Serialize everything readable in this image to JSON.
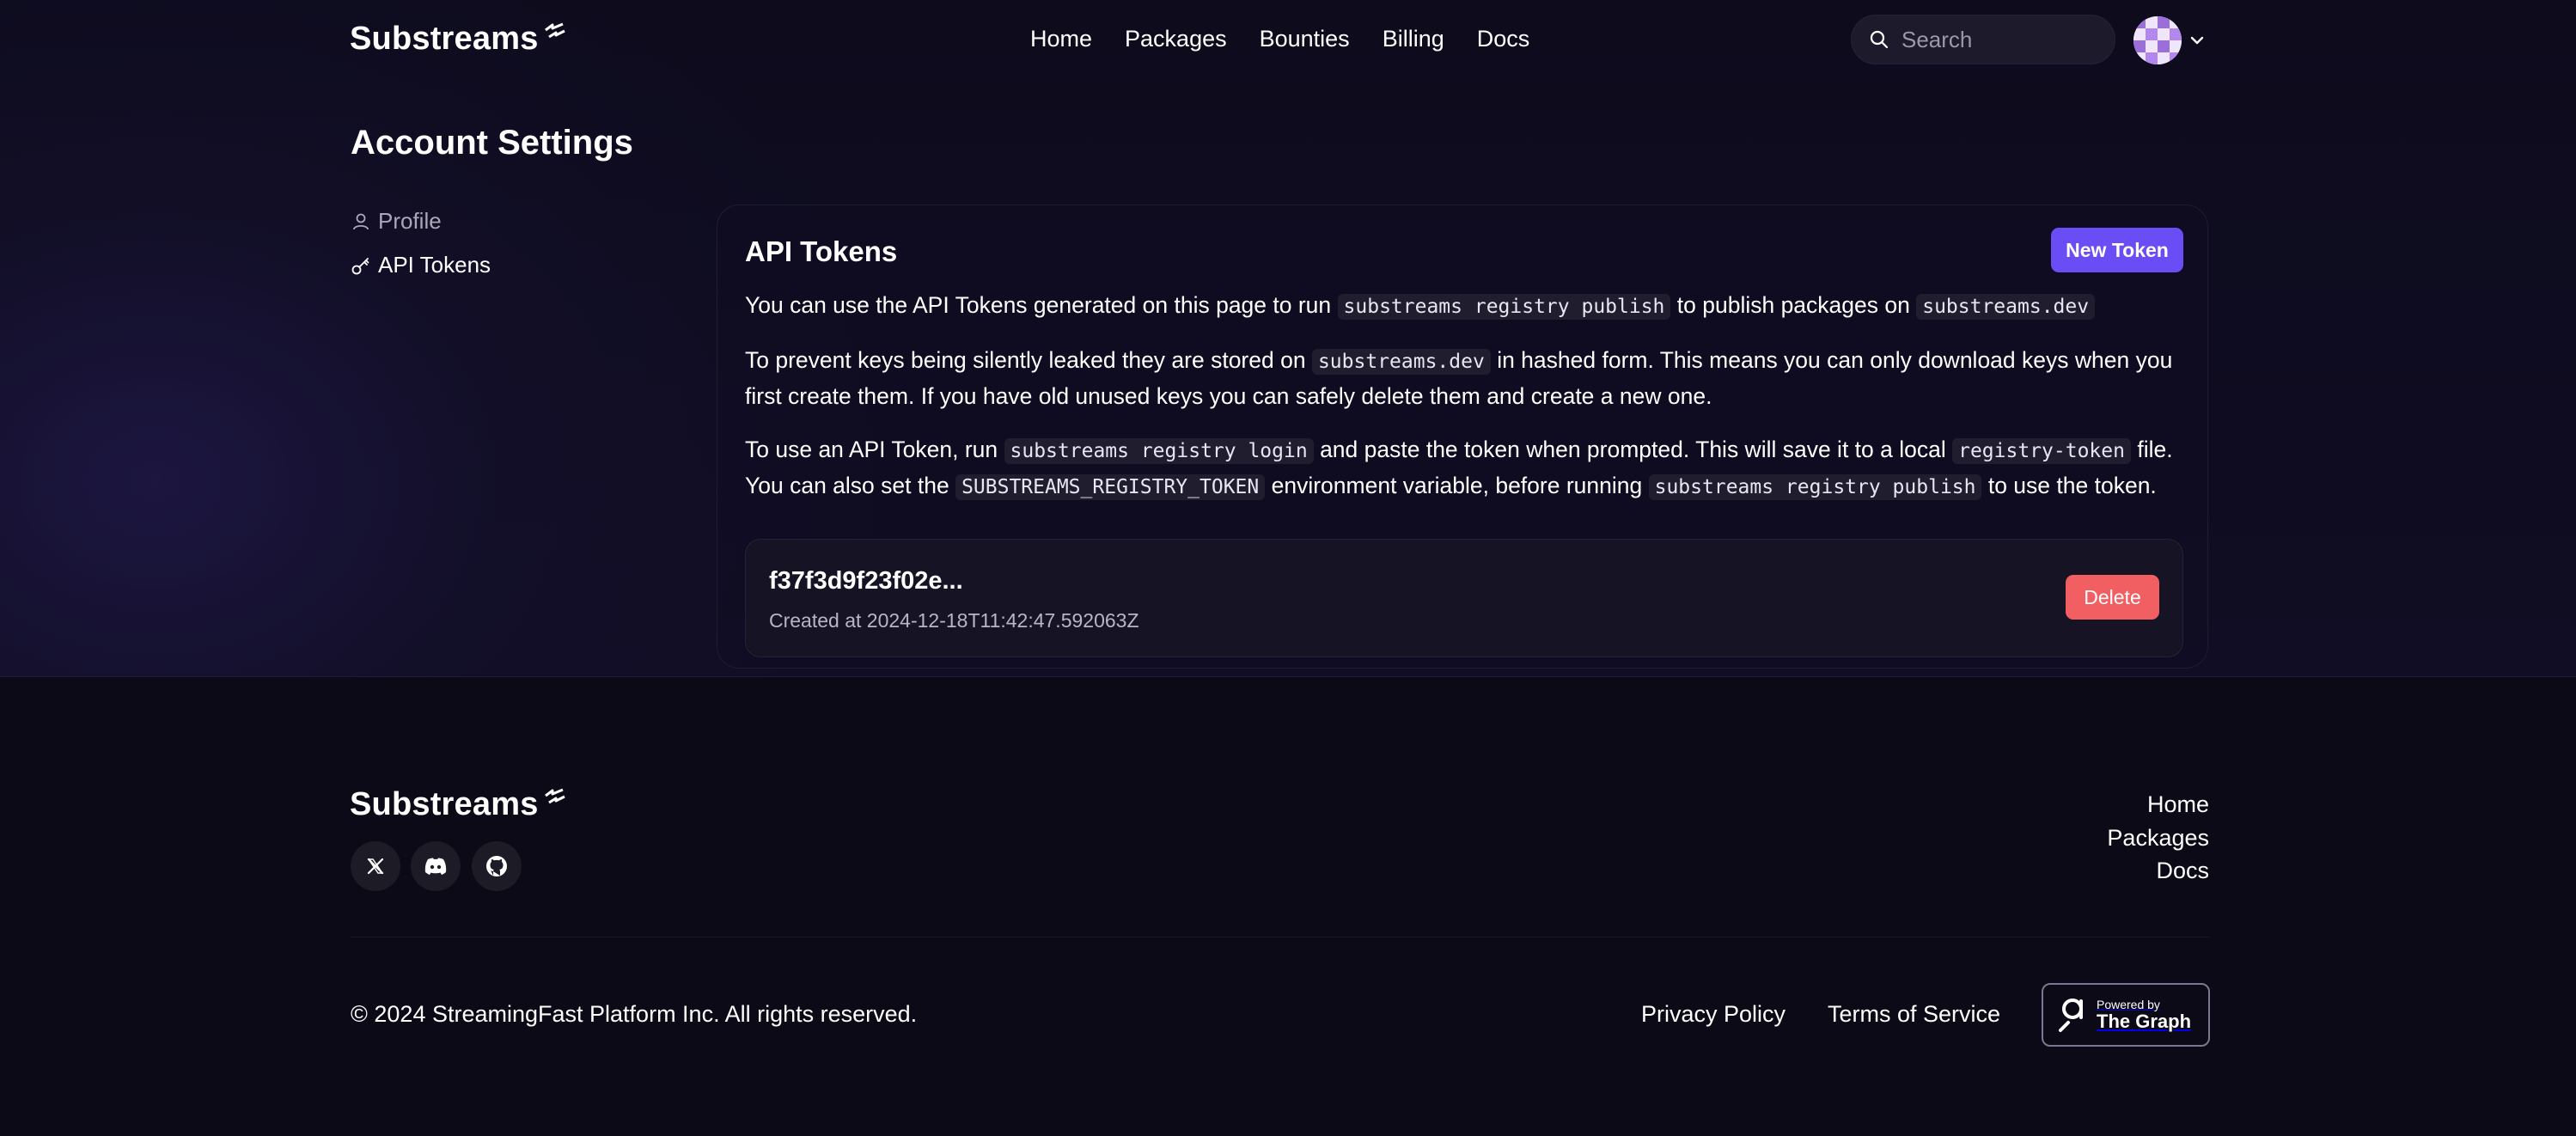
{
  "header": {
    "logo": "Substreams",
    "nav": [
      {
        "label": "Home"
      },
      {
        "label": "Packages"
      },
      {
        "label": "Bounties"
      },
      {
        "label": "Billing"
      },
      {
        "label": "Docs"
      }
    ],
    "search_placeholder": "Search"
  },
  "page": {
    "title": "Account Settings"
  },
  "sidebar": {
    "items": [
      {
        "label": "Profile",
        "icon": "user-icon"
      },
      {
        "label": "API Tokens",
        "icon": "key-icon"
      }
    ]
  },
  "tokens_card": {
    "title": "API Tokens",
    "new_token_label": "New Token",
    "p1": {
      "t1": "You can use the API Tokens generated on this page to run ",
      "c1": "substreams registry publish",
      "t2": " to publish packages on ",
      "c2": "substreams.dev"
    },
    "p2": {
      "t1": "To prevent keys being silently leaked they are stored on ",
      "c1": "substreams.dev",
      "t2": " in hashed form. This means you can only download keys when you first create them. If you have old unused keys you can safely delete them and create a new one."
    },
    "p3": {
      "t1": "To use an API Token, run ",
      "c1": "substreams registry login",
      "t2": " and paste the token when prompted. This will save it to a local ",
      "c2": "registry-token",
      "t3": " file. You can also set the ",
      "c3": "SUBSTREAMS_REGISTRY_TOKEN",
      "t4": " environment variable, before running ",
      "c4": "substreams registry publish",
      "t5": " to use the token."
    },
    "tokens": [
      {
        "name": "f37f3d9f23f02e...",
        "created": "Created at 2024-12-18T11:42:47.592063Z",
        "delete_label": "Delete"
      }
    ]
  },
  "footer": {
    "logo": "Substreams",
    "social": [
      "x-icon",
      "discord-icon",
      "github-icon"
    ],
    "links": [
      {
        "label": "Home"
      },
      {
        "label": "Packages"
      },
      {
        "label": "Docs"
      }
    ],
    "copyright": "© 2024 StreamingFast Platform Inc. All rights reserved.",
    "privacy": "Privacy Policy",
    "terms": "Terms of Service",
    "powered_small": "Powered by",
    "powered_big": "The Graph"
  },
  "colors": {
    "accent": "#6a4df5",
    "danger": "#f25f63",
    "background": "#0b0a16"
  }
}
